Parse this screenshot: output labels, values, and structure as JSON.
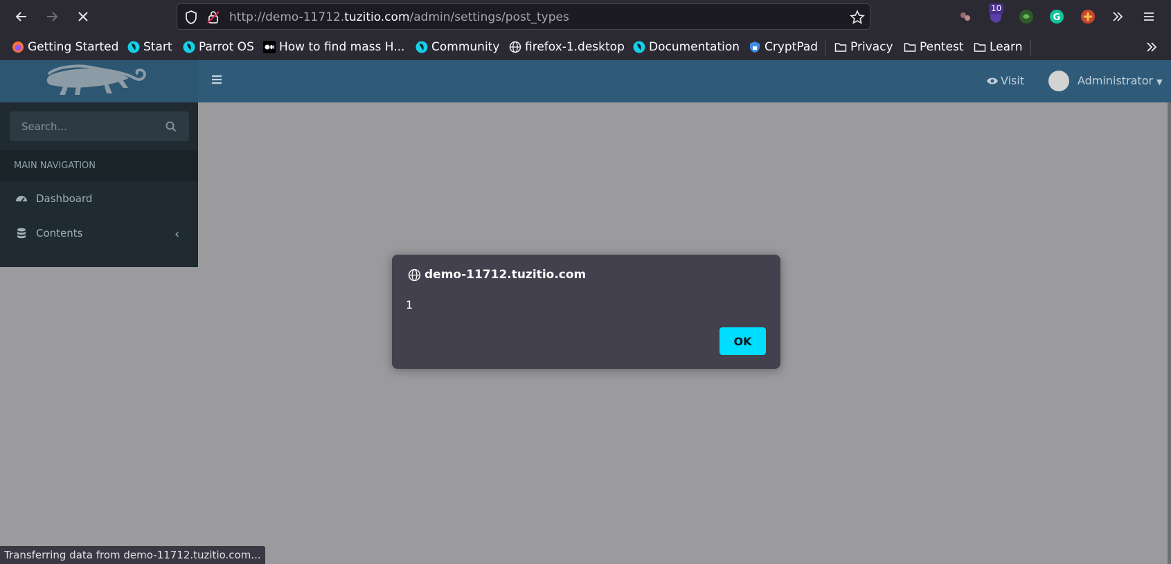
{
  "browser": {
    "url_prefix": "http://demo-11712.",
    "url_host": "tuzitio.com",
    "url_path": "/admin/settings/post_types",
    "extension_badge": "10",
    "bookmarks": [
      {
        "label": "Getting Started",
        "icon": "firefox-icon"
      },
      {
        "label": "Start",
        "icon": "parrot-icon"
      },
      {
        "label": "Parrot OS",
        "icon": "parrot-icon"
      },
      {
        "label": "How to find mass H...",
        "icon": "medium-icon"
      },
      {
        "label": "Community",
        "icon": "parrot-icon"
      },
      {
        "label": "firefox-1.desktop",
        "icon": "globe-icon"
      },
      {
        "label": "Documentation",
        "icon": "parrot-icon"
      },
      {
        "label": "CryptPad",
        "icon": "cryptpad-icon"
      },
      {
        "label": "Privacy",
        "icon": "folder-icon"
      },
      {
        "label": "Pentest",
        "icon": "folder-icon"
      },
      {
        "label": "Learn",
        "icon": "folder-icon"
      }
    ],
    "status_text": "Transferring data from demo-11712.tuzitio.com..."
  },
  "admin": {
    "visit_label": "Visit",
    "user_label": "Administrator",
    "search_placeholder": "Search...",
    "nav_header": "MAIN NAVIGATION",
    "menu": [
      {
        "label": "Dashboard",
        "icon": "dashboard-icon"
      },
      {
        "label": "Contents",
        "icon": "database-icon"
      }
    ]
  },
  "dialog": {
    "title": "demo-11712.tuzitio.com",
    "message": "1",
    "ok_label": "OK"
  },
  "colors": {
    "accent": "#00ddff",
    "topbar": "#2f5b79",
    "sidebar": "#1f2a31",
    "dialog_bg": "#42414d"
  }
}
